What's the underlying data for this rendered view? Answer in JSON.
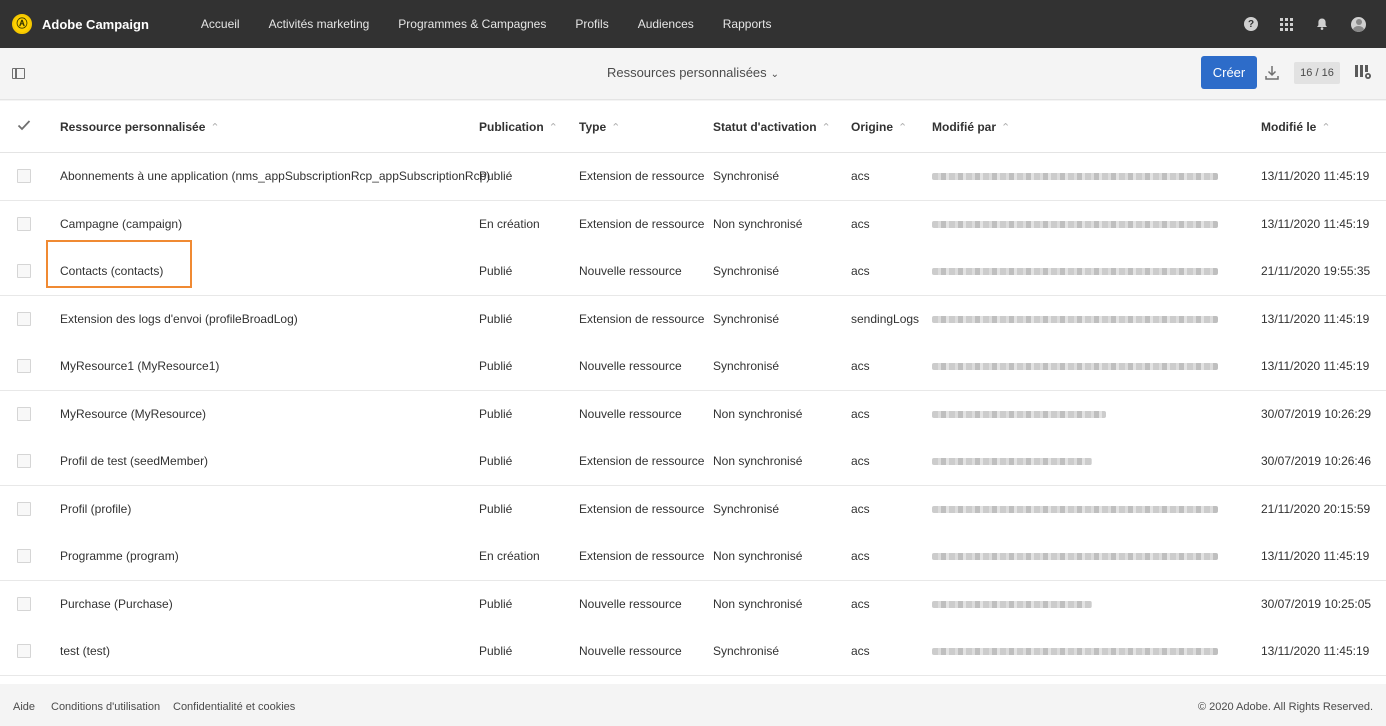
{
  "topnav": {
    "logo_glyph": "Ⓐ",
    "app_name": "Adobe Campaign",
    "items": [
      "Accueil",
      "Activités marketing",
      "Programmes & Campagnes",
      "Profils",
      "Audiences",
      "Rapports"
    ],
    "help_glyph": "?"
  },
  "toolbar": {
    "title": "Ressources personnalisées",
    "title_chevron": "⌄",
    "create_label": "Créer",
    "counter": "16 / 16"
  },
  "table": {
    "headers": {
      "resource": "Ressource personnalisée",
      "publication": "Publication",
      "type": "Type",
      "activation": "Statut d'activation",
      "origin": "Origine",
      "modified_by": "Modifié par",
      "modified_on": "Modifié le"
    },
    "sort_glyph": "⌃",
    "rows": [
      {
        "name": "Abonnements à une application (nms_appSubscriptionRcp_appSubscriptionRcp)",
        "publication": "Publié",
        "type": "Extension de ressource",
        "status": "Synchronisé",
        "origin": "acs",
        "modified_on": "13/11/2020 11:45:19"
      },
      {
        "name": "Campagne (campaign)",
        "publication": "En création",
        "type": "Extension de ressource",
        "status": "Non synchronisé",
        "origin": "acs",
        "modified_on": "13/11/2020 11:45:19"
      },
      {
        "name": "Contacts (contacts)",
        "publication": "Publié",
        "type": "Nouvelle ressource",
        "status": "Synchronisé",
        "origin": "acs",
        "modified_on": "21/11/2020 19:55:35"
      },
      {
        "name": "Extension des logs d'envoi (profileBroadLog)",
        "publication": "Publié",
        "type": "Extension de ressource",
        "status": "Synchronisé",
        "origin": "sendingLogs",
        "modified_on": "13/11/2020 11:45:19"
      },
      {
        "name": "MyResource1 (MyResource1)",
        "publication": "Publié",
        "type": "Nouvelle ressource",
        "status": "Synchronisé",
        "origin": "acs",
        "modified_on": "13/11/2020 11:45:19"
      },
      {
        "name": "MyResource (MyResource)",
        "publication": "Publié",
        "type": "Nouvelle ressource",
        "status": "Non synchronisé",
        "origin": "acs",
        "modified_on": "30/07/2019 10:26:29"
      },
      {
        "name": "Profil de test (seedMember)",
        "publication": "Publié",
        "type": "Extension de ressource",
        "status": "Non synchronisé",
        "origin": "acs",
        "modified_on": "30/07/2019 10:26:46"
      },
      {
        "name": "Profil (profile)",
        "publication": "Publié",
        "type": "Extension de ressource",
        "status": "Synchronisé",
        "origin": "acs",
        "modified_on": "21/11/2020 20:15:59"
      },
      {
        "name": "Programme (program)",
        "publication": "En création",
        "type": "Extension de ressource",
        "status": "Non synchronisé",
        "origin": "acs",
        "modified_on": "13/11/2020 11:45:19"
      },
      {
        "name": "Purchase (Purchase)",
        "publication": "Publié",
        "type": "Nouvelle ressource",
        "status": "Non synchronisé",
        "origin": "acs",
        "modified_on": "30/07/2019 10:25:05"
      },
      {
        "name": "test (test)",
        "publication": "Publié",
        "type": "Nouvelle ressource",
        "status": "Synchronisé",
        "origin": "acs",
        "modified_on": "13/11/2020 11:45:19"
      }
    ]
  },
  "footer": {
    "links": [
      "Aide",
      "Conditions d'utilisation",
      "Confidentialité et cookies"
    ],
    "copyright": "© 2020 Adobe. All Rights Reserved."
  },
  "colors": {
    "topnav_bg": "#323232",
    "accent": "#2d6cc9",
    "highlight": "#f08a33"
  }
}
